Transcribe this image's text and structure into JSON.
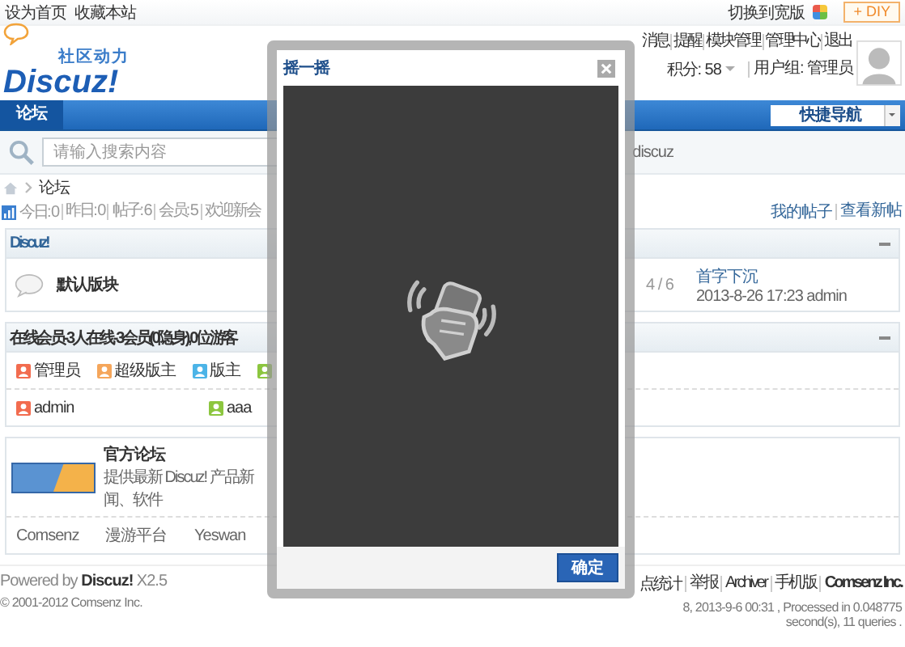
{
  "top_bar": {
    "links": [
      "设为首页",
      "收藏本站"
    ],
    "switch_link": "切换到宽版",
    "diy_button": "+ DIY"
  },
  "header": {
    "logo": {
      "tagline": "社区动力",
      "name": "Discuz!"
    },
    "user_links": [
      "消息",
      "提醒",
      "模块管理",
      "管理中心",
      "退出"
    ],
    "credits": "积分: 58",
    "user_group": "用户组: 管理员"
  },
  "nav": {
    "tabs": [
      {
        "label": "论坛",
        "selected": true
      }
    ],
    "quick_nav": "快捷导航"
  },
  "search": {
    "placeholder": "请输入搜索内容",
    "hot_keyword": "discuz"
  },
  "breadcrumb": [
    "论坛"
  ],
  "stats": {
    "items": [
      "今日: 0",
      "昨日: 0",
      "帖子: 6",
      "会员: 5",
      "欢迎新会"
    ],
    "links": [
      "我的帖子",
      "查看新帖"
    ]
  },
  "forum_box": {
    "title": "Discuz!",
    "forums": [
      {
        "name": "默认版块",
        "counts": "4 / 6",
        "last_post_title": "首字下沉",
        "last_post_meta": "2013-8-26 17:23 admin"
      }
    ]
  },
  "online_box": {
    "title": "在线会员 - 3 人在线 - 3 会员(0 隐身), 0 位游客",
    "legend": [
      {
        "label": "管理员",
        "color": "#f26c4f"
      },
      {
        "label": "超级版主",
        "color": "#f5a65b"
      },
      {
        "label": "版主",
        "color": "#4cb4e7"
      },
      {
        "color": "#8cc63f"
      }
    ],
    "members": [
      {
        "name": "admin",
        "color": "#f26c4f"
      },
      {
        "name": "aaa",
        "color": "#8cc63f"
      }
    ]
  },
  "links_box": {
    "featured": {
      "title": "官方论坛",
      "description": "提供最新 Discuz! 产品新闻、软件"
    },
    "links": [
      "Comsenz",
      "漫游平台",
      "Yeswan"
    ]
  },
  "footer": {
    "powered": "Powered by **Discuz!** X2.5",
    "copyright": "© 2001-2012 Comsenz Inc.",
    "links": [
      "点统计",
      "举报",
      "Archiver",
      "手机版",
      "Comsenz Inc."
    ],
    "stats": "8, 2013-9-6 00:31 , Processed in 0.048775 second(s), 11 queries ."
  },
  "dialog": {
    "title": "摇一摇",
    "confirm_button": "确定"
  }
}
